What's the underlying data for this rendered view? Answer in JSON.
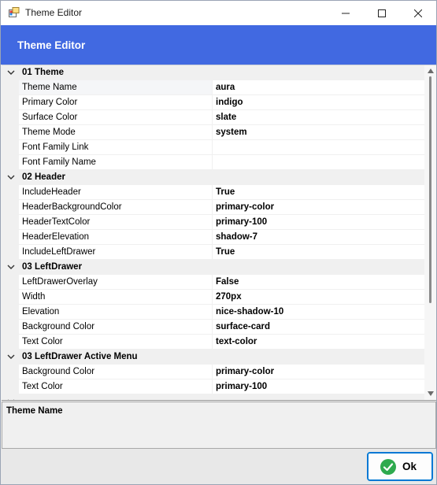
{
  "window": {
    "title": "Theme Editor"
  },
  "banner": {
    "title": "Theme Editor"
  },
  "grid": {
    "categories": [
      {
        "label": "01 Theme",
        "props": [
          {
            "name": "Theme Name",
            "value": "aura"
          },
          {
            "name": "Primary Color",
            "value": "indigo"
          },
          {
            "name": "Surface Color",
            "value": "slate"
          },
          {
            "name": "Theme Mode",
            "value": "system"
          },
          {
            "name": "Font Family Link",
            "value": ""
          },
          {
            "name": "Font Family Name",
            "value": ""
          }
        ]
      },
      {
        "label": "02 Header",
        "props": [
          {
            "name": "IncludeHeader",
            "value": "True"
          },
          {
            "name": "HeaderBackgroundColor",
            "value": "primary-color"
          },
          {
            "name": "HeaderTextColor",
            "value": "primary-100"
          },
          {
            "name": "HeaderElevation",
            "value": "shadow-7"
          },
          {
            "name": "IncludeLeftDrawer",
            "value": "True"
          }
        ]
      },
      {
        "label": "03 LeftDrawer",
        "props": [
          {
            "name": "LeftDrawerOverlay",
            "value": "False"
          },
          {
            "name": "Width",
            "value": "270px"
          },
          {
            "name": "Elevation",
            "value": "nice-shadow-10"
          },
          {
            "name": "Background Color",
            "value": "surface-card"
          },
          {
            "name": "Text Color",
            "value": "text-color"
          }
        ]
      },
      {
        "label": "03 LeftDrawer Active Menu",
        "props": [
          {
            "name": "Background Color",
            "value": "primary-color"
          },
          {
            "name": "Text Color",
            "value": "primary-100"
          }
        ]
      }
    ]
  },
  "description": {
    "title": "Theme Name"
  },
  "footer": {
    "ok_label": "Ok"
  },
  "colors": {
    "banner": "#4169e1",
    "ok_icon": "#2eaa4e",
    "accent": "#0078d4"
  },
  "icons": {
    "app": "app-palette-icon",
    "expand": "chevron-down-icon",
    "ok": "check-circle-icon"
  }
}
